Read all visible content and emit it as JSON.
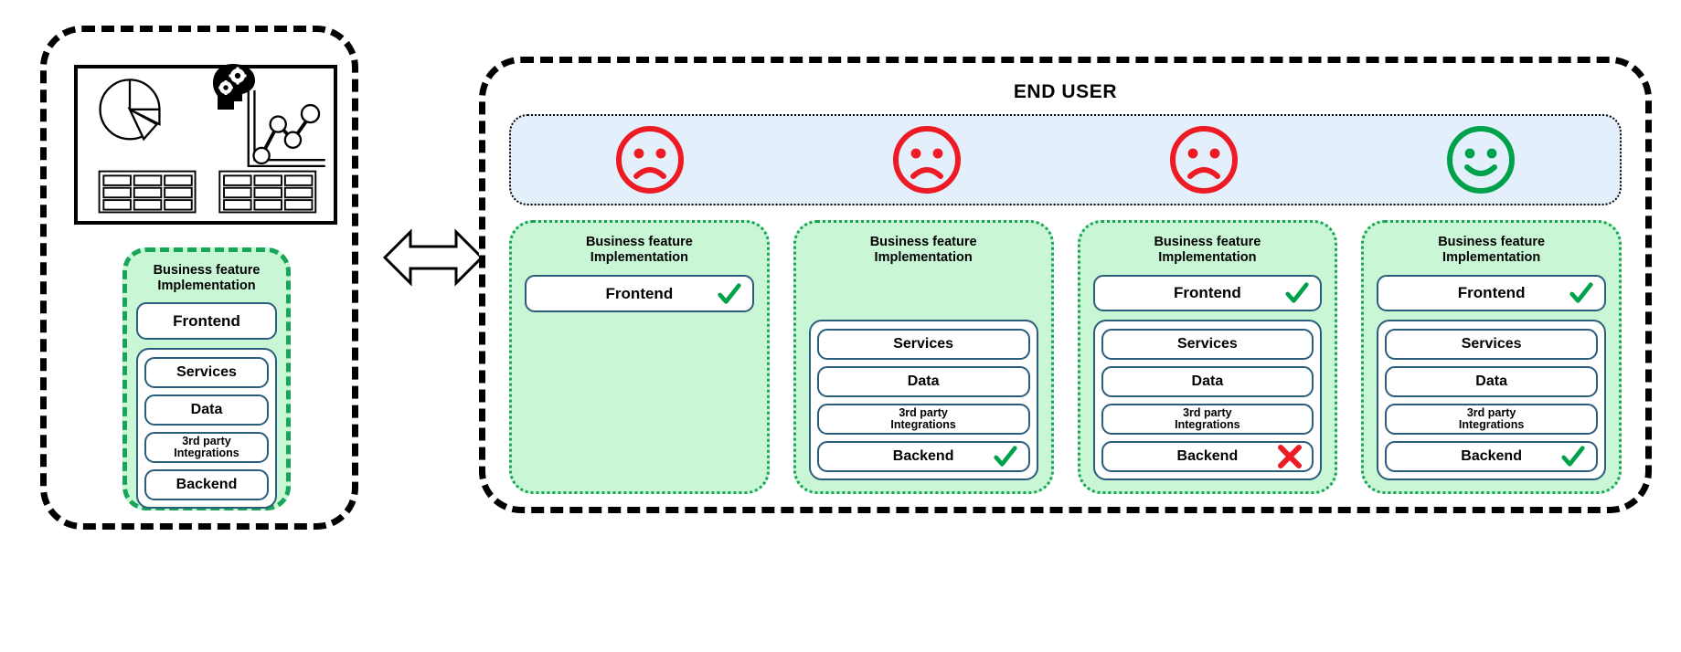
{
  "colors": {
    "frame_black": "#000000",
    "green_dash": "#18a558",
    "green_fill": "#c9f7d5",
    "pill_border": "#2a5d7c",
    "blue_band": "#e3effb",
    "sad_red": "#ED1C24",
    "happy_green": "#00A14B",
    "check_green": "#00A14B",
    "cross_red": "#ED1C24"
  },
  "left_panel": {
    "dashboard": {
      "icons": [
        "pie-chart-icon",
        "brain-gears-head-icon",
        "line-chart-icon",
        "table-grid-icon",
        "table-grid-icon"
      ]
    },
    "feature_box": {
      "title_line1": "Business feature",
      "title_line2": "Implementation",
      "frontend": "Frontend",
      "stack": [
        "Services",
        "Data",
        "3rd party\nIntegrations",
        "Backend"
      ],
      "stack_items": [
        {
          "label": "Services",
          "size": "md"
        },
        {
          "label": "Data",
          "size": "md"
        },
        {
          "label_line1": "3rd party",
          "label_line2": "Integrations",
          "size": "sm"
        },
        {
          "label": "Backend",
          "size": "md"
        }
      ]
    }
  },
  "arrow": {
    "name": "double-headed-arrow",
    "direction": "left-right"
  },
  "right_panel": {
    "title": "END USER",
    "faces": [
      {
        "mood": "sad",
        "icon": "sad-face-icon",
        "color": "#ED1C24"
      },
      {
        "mood": "sad",
        "icon": "sad-face-icon",
        "color": "#ED1C24"
      },
      {
        "mood": "sad",
        "icon": "sad-face-icon",
        "color": "#ED1C24"
      },
      {
        "mood": "happy",
        "icon": "happy-face-icon",
        "color": "#00A14B"
      }
    ],
    "cards": [
      {
        "title_line1": "Business feature",
        "title_line2": "Implementation",
        "frontend": {
          "label": "Frontend",
          "mark": "check"
        },
        "has_stack": false,
        "stack": []
      },
      {
        "title_line1": "Business feature",
        "title_line2": "Implementation",
        "frontend": null,
        "has_stack": true,
        "stack": [
          {
            "label": "Services",
            "size": "md",
            "mark": "none"
          },
          {
            "label": "Data",
            "size": "md",
            "mark": "none"
          },
          {
            "label_line1": "3rd party",
            "label_line2": "Integrations",
            "size": "sm",
            "mark": "none"
          },
          {
            "label": "Backend",
            "size": "md",
            "mark": "check"
          }
        ]
      },
      {
        "title_line1": "Business feature",
        "title_line2": "Implementation",
        "frontend": {
          "label": "Frontend",
          "mark": "check"
        },
        "has_stack": true,
        "stack": [
          {
            "label": "Services",
            "size": "md",
            "mark": "none"
          },
          {
            "label": "Data",
            "size": "md",
            "mark": "none"
          },
          {
            "label_line1": "3rd party",
            "label_line2": "Integrations",
            "size": "sm",
            "mark": "none"
          },
          {
            "label": "Backend",
            "size": "md",
            "mark": "cross"
          }
        ]
      },
      {
        "title_line1": "Business feature",
        "title_line2": "Implementation",
        "frontend": {
          "label": "Frontend",
          "mark": "check"
        },
        "has_stack": true,
        "stack": [
          {
            "label": "Services",
            "size": "md",
            "mark": "none"
          },
          {
            "label": "Data",
            "size": "md",
            "mark": "none"
          },
          {
            "label_line1": "3rd party",
            "label_line2": "Integrations",
            "size": "sm",
            "mark": "none"
          },
          {
            "label": "Backend",
            "size": "md",
            "mark": "check"
          }
        ]
      }
    ]
  }
}
